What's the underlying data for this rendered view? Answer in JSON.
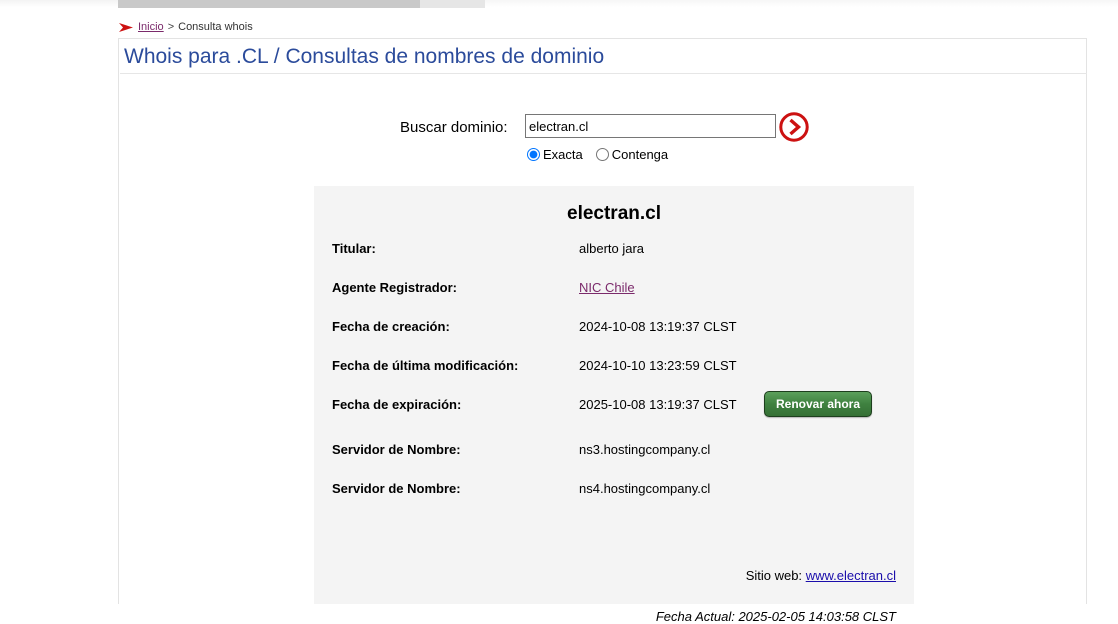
{
  "breadcrumb": {
    "arrow_icon": "red-arrow-icon",
    "home": "Inicio",
    "separator": ">",
    "current": "Consulta whois"
  },
  "page": {
    "title": "Whois para .CL / Consultas de nombres de dominio"
  },
  "search": {
    "label": "Buscar dominio:",
    "value": "electran.cl",
    "placeholder": "",
    "submit_icon": "go-arrow-circle-icon",
    "options": [
      {
        "label": "Exacta",
        "value": "exacta",
        "selected": true
      },
      {
        "label": "Contenga",
        "value": "contenga",
        "selected": false
      }
    ]
  },
  "result": {
    "domain": "electran.cl",
    "rows": [
      {
        "label": "Titular:",
        "value": "alberto jara",
        "type": "text"
      },
      {
        "label": "Agente Registrador:",
        "value": "NIC Chile",
        "type": "link"
      },
      {
        "label": "Fecha de creación:",
        "value": "2024-10-08 13:19:37 CLST",
        "type": "text"
      },
      {
        "label": "Fecha de última modificación:",
        "value": "2024-10-10 13:23:59 CLST",
        "type": "text"
      },
      {
        "label": "Fecha de expiración:",
        "value": "2025-10-08 13:19:37 CLST",
        "type": "text",
        "action": "Renovar ahora"
      },
      {
        "label": "Servidor de Nombre:",
        "value": "ns3.hostingcompany.cl",
        "type": "text"
      },
      {
        "label": "Servidor de Nombre:",
        "value": "ns4.hostingcompany.cl",
        "type": "text"
      }
    ],
    "renew_button": "Renovar ahora",
    "site_label": "Sitio web:",
    "site_url": "www.electran.cl",
    "current_date": "Fecha Actual: 2025-02-05 14:03:58 CLST"
  },
  "colors": {
    "title_blue": "#2b4b9b",
    "accent_red": "#cc1111",
    "visited_link": "#7b2a6b",
    "link_blue": "#1a0dab",
    "renew_green": "#3f8140",
    "panel_bg": "#f4f4f4"
  }
}
